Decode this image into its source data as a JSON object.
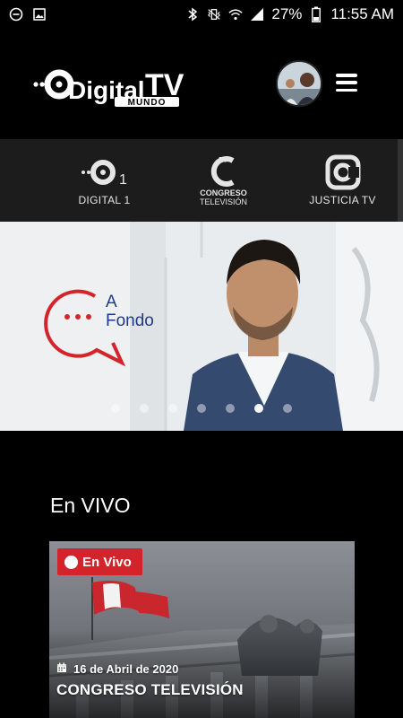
{
  "status_bar": {
    "battery_percent": "27%",
    "time": "11:55 AM",
    "left_icons": [
      "minus-circle-icon",
      "image-icon"
    ],
    "right_icons": [
      "bluetooth-icon",
      "vibrate-mute-icon",
      "wifi-icon",
      "signal-icon",
      "battery-icon"
    ]
  },
  "header": {
    "logo_main": "Digital",
    "logo_tv": "TV",
    "logo_sub": "MUNDO",
    "menu_icon": "hamburger-menu-icon",
    "avatar_icon": "avatar"
  },
  "channels": [
    {
      "name": "DIGITAL 1",
      "number": "1",
      "icon": "digital-1-logo-icon"
    },
    {
      "name_line1": "CONGRESO",
      "name_line2": "TELEVISIÓN",
      "icon": "congreso-logo-icon"
    },
    {
      "name": "JUSTICIA TV",
      "icon": "justicia-tv-logo-icon"
    }
  ],
  "banner": {
    "brand_line1": "A",
    "brand_line2": "Fondo",
    "dot_count": 7,
    "active_dot": 6
  },
  "live_section": {
    "title": "En VIVO",
    "card": {
      "badge": "En Vivo",
      "date": "16 de Abril de 2020",
      "title": "CONGRESO TELEVISIÓN"
    }
  },
  "colors": {
    "accent_red": "#d4242b",
    "background": "#000000",
    "strip": "#1c1c1c",
    "brand_blue": "#1f3a8a"
  }
}
